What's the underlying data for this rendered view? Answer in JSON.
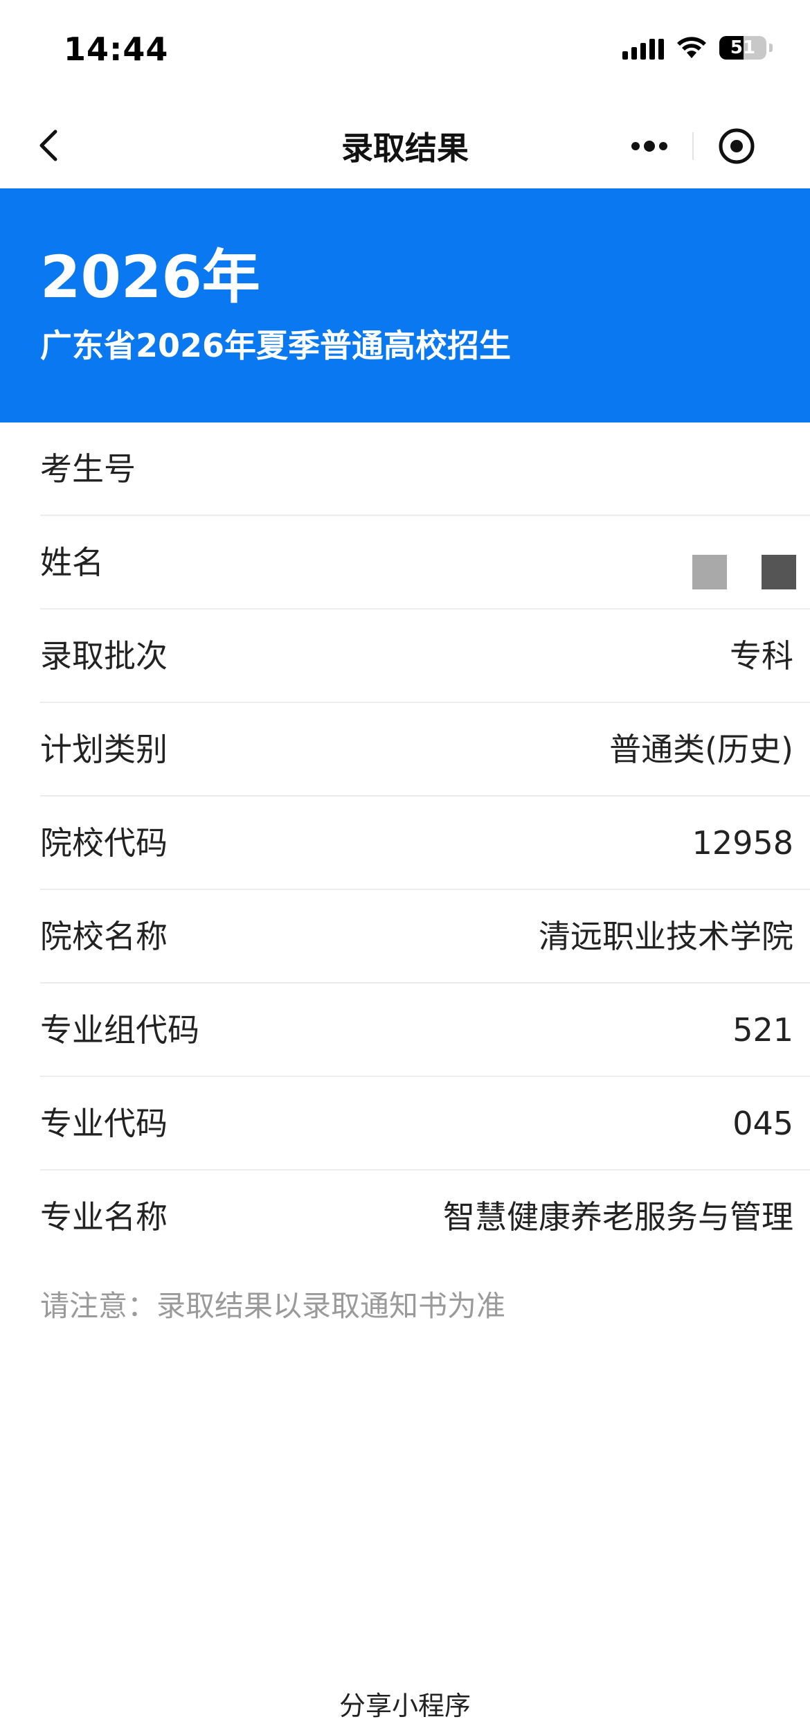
{
  "status_bar": {
    "time": "14:44",
    "battery_level": "51",
    "battery_fraction": 0.51,
    "icons": [
      "signal-icon",
      "wifi-icon",
      "battery-icon"
    ]
  },
  "nav": {
    "title": "录取结果",
    "icons": [
      "back-icon",
      "more-icon",
      "close-target-icon"
    ]
  },
  "banner": {
    "year": "2026年",
    "subtitle": "广东省2026年夏季普通高校招生",
    "color": "#0a78f0"
  },
  "fields": [
    {
      "label": "考生号",
      "value": ""
    },
    {
      "label": "姓名",
      "value": ""
    },
    {
      "label": "录取批次",
      "value": "专科"
    },
    {
      "label": "计划类别",
      "value": "普通类(历史)"
    },
    {
      "label": "院校代码",
      "value": "12958"
    },
    {
      "label": "院校名称",
      "value": "清远职业技术学院"
    },
    {
      "label": "专业组代码",
      "value": "521"
    },
    {
      "label": "专业代码",
      "value": "045"
    },
    {
      "label": "专业名称",
      "value": "智慧健康养老服务与管理"
    }
  ],
  "notice": "请注意：录取结果以录取通知书为准",
  "footer": {
    "share_label": "分享小程序"
  }
}
